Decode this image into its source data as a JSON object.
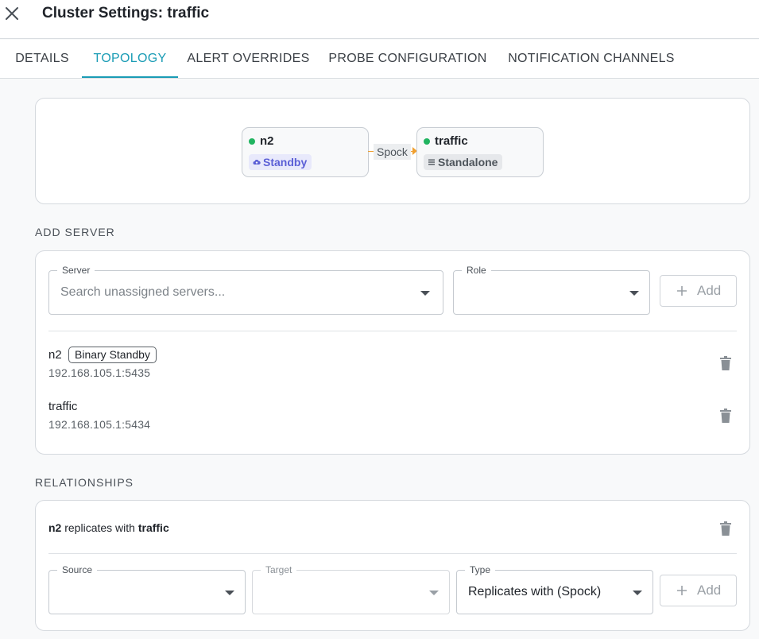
{
  "header": {
    "title": "Cluster Settings: traffic"
  },
  "tabs": [
    "DETAILS",
    "TOPOLOGY",
    "ALERT OVERRIDES",
    "PROBE CONFIGURATION",
    "NOTIFICATION CHANNELS"
  ],
  "active_tab": "TOPOLOGY",
  "topology": {
    "nodes": [
      {
        "name": "n2",
        "role": "Standby",
        "status_color": "#21b460",
        "role_icon": "cloud-icon"
      },
      {
        "name": "traffic",
        "role": "Standalone",
        "status_color": "#21b460",
        "role_icon": "list-icon"
      }
    ],
    "edge": {
      "label": "Spock",
      "color": "#f0a030"
    }
  },
  "add_server": {
    "section_label": "ADD SERVER",
    "server_label": "Server",
    "server_placeholder": "Search unassigned servers...",
    "role_label": "Role",
    "role_value": "",
    "add_label": "Add"
  },
  "servers": [
    {
      "name": "n2",
      "role": "Binary Standby",
      "address": "192.168.105.1:5435"
    },
    {
      "name": "traffic",
      "role": "",
      "address": "192.168.105.1:5434"
    }
  ],
  "relationships": {
    "section_label": "RELATIONSHIPS",
    "items": [
      {
        "source": "n2",
        "verb": "replicates with",
        "target": "traffic"
      }
    ],
    "source_label": "Source",
    "source_value": "",
    "target_label": "Target",
    "target_value": "",
    "type_label": "Type",
    "type_value": "Replicates with (Spock)",
    "add_label": "Add"
  },
  "colors": {
    "accent": "#1a9cb5",
    "status_ok": "#21b460",
    "standby_badge": "#5b5fd6"
  }
}
